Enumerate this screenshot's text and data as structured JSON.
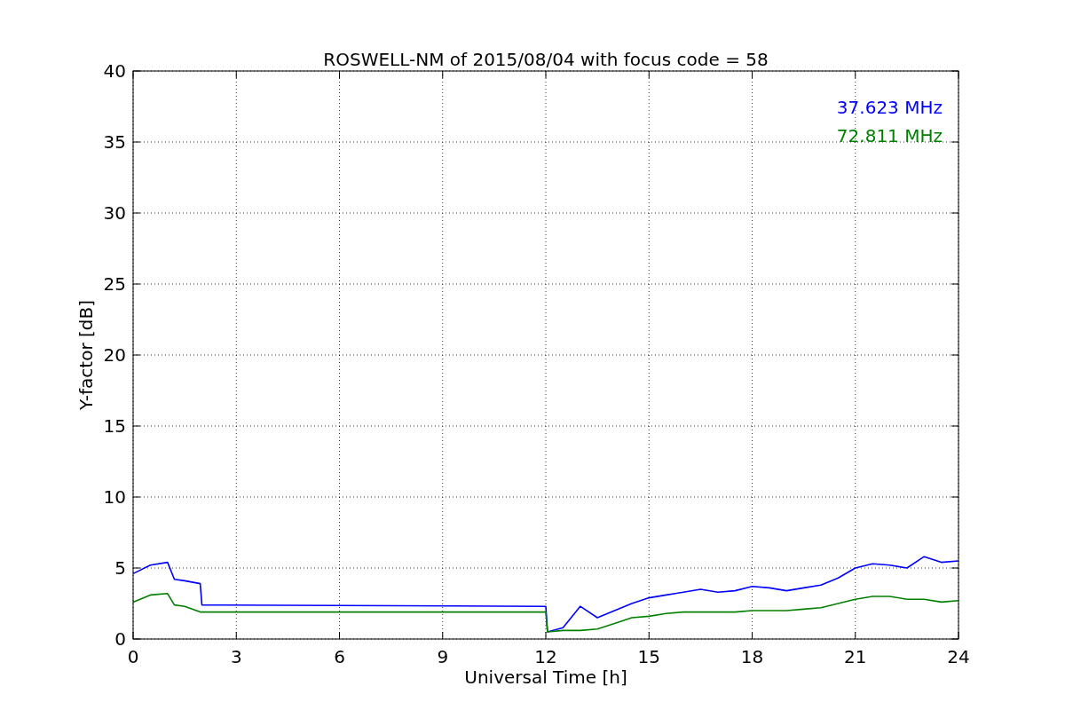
{
  "chart_data": {
    "type": "line",
    "title": "ROSWELL-NM of 2015/08/04 with focus code = 58",
    "xlabel": "Universal Time [h]",
    "ylabel": "Y-factor [dB]",
    "x": [
      0,
      0.5,
      1,
      1.2,
      1.5,
      1.95,
      2,
      12,
      12.05,
      12.5,
      13,
      13.5,
      14,
      14.5,
      15,
      15.5,
      16,
      16.5,
      17,
      17.5,
      18,
      18.5,
      19,
      19.5,
      20,
      20.5,
      21,
      21.5,
      22,
      22.5,
      23,
      23.5,
      24
    ],
    "series": [
      {
        "name": "37.623 MHz",
        "color": "#0000ff",
        "values": [
          4.6,
          5.2,
          5.4,
          4.2,
          4.1,
          3.9,
          2.4,
          2.3,
          0.5,
          0.8,
          2.3,
          1.5,
          2.0,
          2.5,
          2.9,
          3.1,
          3.3,
          3.5,
          3.3,
          3.4,
          3.7,
          3.6,
          3.4,
          3.6,
          3.8,
          4.3,
          5.0,
          5.3,
          5.2,
          5.0,
          5.8,
          5.4,
          5.5
        ]
      },
      {
        "name": "72.811 MHz",
        "color": "#008000",
        "values": [
          2.6,
          3.1,
          3.2,
          2.4,
          2.3,
          1.9,
          1.9,
          1.9,
          0.5,
          0.6,
          0.6,
          0.7,
          1.1,
          1.5,
          1.6,
          1.8,
          1.9,
          1.9,
          1.9,
          1.9,
          2.0,
          2.0,
          2.0,
          2.1,
          2.2,
          2.5,
          2.8,
          3.0,
          3.0,
          2.8,
          2.8,
          2.6,
          2.7
        ]
      }
    ],
    "xlim": [
      0,
      24
    ],
    "ylim": [
      0,
      40
    ],
    "grid": true,
    "xticks": [
      0,
      3,
      6,
      9,
      12,
      15,
      18,
      21,
      24
    ],
    "yticks": [
      0,
      5,
      10,
      15,
      20,
      25,
      30,
      35,
      40
    ]
  }
}
